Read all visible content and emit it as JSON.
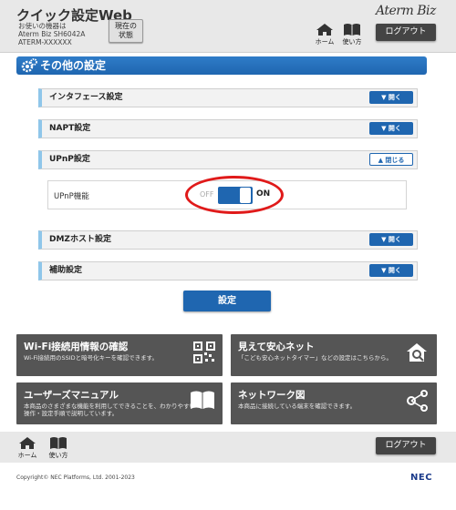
{
  "header": {
    "app_title": "クイック設定Web",
    "device_line1": "お使いの機器は",
    "device_line2": "Aterm Biz SH6042A",
    "device_line3": "ATERM-XXXXXX",
    "status_line1": "現在の",
    "status_line2": "状態",
    "brand": "Aterm Biz",
    "home_label": "ホーム",
    "usage_label": "使い方",
    "logout_label": "ログアウト"
  },
  "section": {
    "title": "その他の設定"
  },
  "accordion": [
    {
      "label": "インタフェース設定",
      "button": "開く",
      "state": "closed"
    },
    {
      "label": "NAPT設定",
      "button": "開く",
      "state": "closed"
    },
    {
      "label": "UPnP設定",
      "button": "閉じる",
      "state": "open"
    },
    {
      "label": "DMZホスト設定",
      "button": "開く",
      "state": "closed"
    },
    {
      "label": "補助設定",
      "button": "開く",
      "state": "closed"
    }
  ],
  "upnp": {
    "label": "UPnP機能",
    "off_text": "OFF",
    "on_text": "ON",
    "enabled": true
  },
  "setting_button": "設定",
  "tiles": {
    "wifi": {
      "title": "Wi-Fi接続用情報の確認",
      "desc": "Wi-Fi接続用のSSIDと暗号化キーを確認できます。",
      "icon": "qr-code-icon"
    },
    "safety": {
      "title": "見えて安心ネット",
      "desc": "「こども安心ネットタイマー」などの設定はこちらから。",
      "icon": "home-search-icon"
    },
    "manual": {
      "title": "ユーザーズマニュアル",
      "desc": "本商品のさまざまな機能を利用してできることを、わかりやすい操作・設定手順で説明しています。",
      "icon": "book-icon"
    },
    "network": {
      "title": "ネットワーク図",
      "desc": "本商品に接続している端末を確認できます。",
      "icon": "network-icon"
    }
  },
  "footer": {
    "home_label": "ホーム",
    "usage_label": "使い方",
    "logout_label": "ログアウト",
    "copyright": "Copyright© NEC Platforms, Ltd. 2001-2023",
    "nec": "NEC"
  },
  "colors": {
    "accent": "#1f66b0",
    "highlight": "#e01a1a",
    "tile": "#555555"
  }
}
